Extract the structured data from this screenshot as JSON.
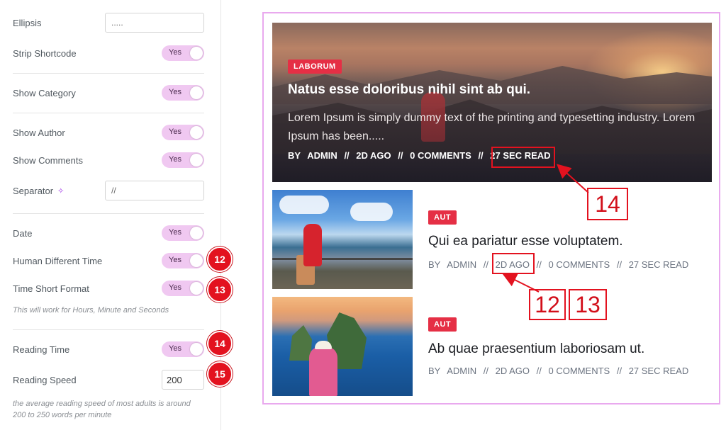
{
  "settings": {
    "ellipsis": {
      "label": "Ellipsis",
      "value": "....."
    },
    "strip_shortcode": {
      "label": "Strip Shortcode",
      "toggle": "Yes"
    },
    "show_category": {
      "label": "Show Category",
      "toggle": "Yes"
    },
    "show_author": {
      "label": "Show Author",
      "toggle": "Yes"
    },
    "show_comments": {
      "label": "Show Comments",
      "toggle": "Yes"
    },
    "separator": {
      "label": "Separator",
      "value": "//"
    },
    "date": {
      "label": "Date",
      "toggle": "Yes"
    },
    "human_different_time": {
      "label": "Human Different Time",
      "toggle": "Yes",
      "badge": "12"
    },
    "time_short_format": {
      "label": "Time Short Format",
      "toggle": "Yes",
      "badge": "13",
      "hint": "This will work for Hours, Minute and Seconds"
    },
    "reading_time": {
      "label": "Reading Time",
      "toggle": "Yes",
      "badge": "14"
    },
    "reading_speed": {
      "label": "Reading Speed",
      "value": "200",
      "badge": "15",
      "hint": "the average reading speed of most adults is around 200 to 250 words per minute"
    }
  },
  "preview": {
    "featured": {
      "category": "LABORUM",
      "title": "Natus esse doloribus nihil sint ab qui.",
      "excerpt": "Lorem Ipsum is simply dummy text of the printing and typesetting industry. Lorem Ipsum has been.....",
      "meta": {
        "by": "BY",
        "author": "ADMIN",
        "sep": "//",
        "date": "2D AGO",
        "comments": "0 COMMENTS",
        "reading": "27 SEC READ"
      }
    },
    "posts": [
      {
        "category": "AUT",
        "title": "Qui ea pariatur esse voluptatem.",
        "meta": {
          "by": "BY",
          "author": "ADMIN",
          "sep": "//",
          "date": "2D AGO",
          "comments": "0 COMMENTS",
          "reading": "27 SEC READ"
        }
      },
      {
        "category": "AUT",
        "title": "Ab quae praesentium laboriosam ut.",
        "meta": {
          "by": "BY",
          "author": "ADMIN",
          "sep": "//",
          "date": "2D AGO",
          "comments": "0 COMMENTS",
          "reading": "27 SEC READ"
        }
      }
    ]
  },
  "annotations": {
    "reading_callout": "14",
    "date_callout_a": "12",
    "date_callout_b": "13"
  },
  "colors": {
    "accent_toggle": "#f0c8f1",
    "category_badge": "#e52f45",
    "annotation_red": "#e3121f",
    "preview_border": "#e9a9ee"
  }
}
